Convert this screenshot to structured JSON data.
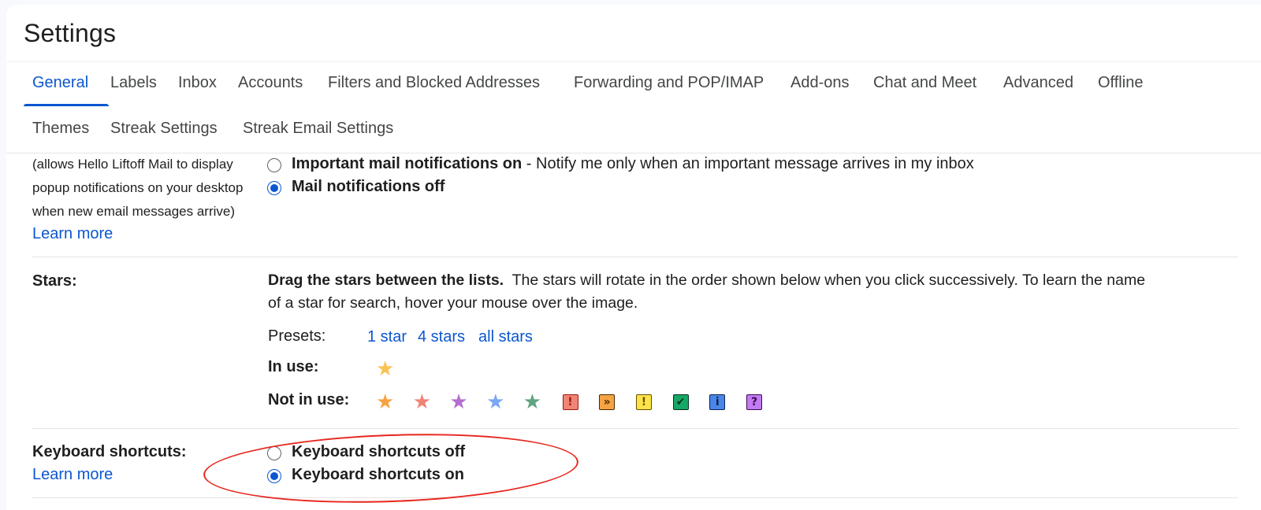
{
  "header": {
    "title": "Settings"
  },
  "tabs": [
    {
      "label": "General",
      "active": true
    },
    {
      "label": "Labels"
    },
    {
      "label": "Inbox"
    },
    {
      "label": "Accounts"
    },
    {
      "label": "Filters and Blocked Addresses"
    },
    {
      "label": "Forwarding and POP/IMAP"
    },
    {
      "label": "Add-ons"
    },
    {
      "label": "Chat and Meet"
    },
    {
      "label": "Advanced"
    },
    {
      "label": "Offline"
    },
    {
      "label": "Themes"
    },
    {
      "label": "Streak Settings"
    },
    {
      "label": "Streak Email Settings"
    }
  ],
  "notifications": {
    "desc_lines": [
      "(allows Hello Liftoff Mail to display",
      "popup notifications on your desktop",
      "when new email messages arrive)"
    ],
    "learn_more": "Learn more",
    "options": [
      {
        "bold": "Important mail notifications on",
        "rest": " - Notify me only when an important message arrives in my inbox",
        "checked": false
      },
      {
        "bold": "Mail notifications off",
        "rest": "",
        "checked": true
      }
    ]
  },
  "stars": {
    "label": "Stars:",
    "intro_bold": "Drag the stars between the lists.",
    "intro_line1": "  The stars will rotate in the order shown below when you click successively. To learn the name",
    "intro_line2": "of a star for search, hover your mouse over the image.",
    "presets_label": "Presets:",
    "presets": [
      "1 star",
      "4 stars",
      "all stars"
    ],
    "in_use_label": "In use:",
    "not_in_use_label": "Not in use:",
    "in_use": [
      {
        "icon": "yellow-star-icon",
        "color": "#fbc254"
      }
    ],
    "not_in_use": [
      {
        "icon": "orange-star-icon",
        "color": "#f6a443"
      },
      {
        "icon": "red-star-icon",
        "color": "#f08476"
      },
      {
        "icon": "purple-star-icon",
        "color": "#b46ece"
      },
      {
        "icon": "blue-star-icon",
        "color": "#7ba7f4"
      },
      {
        "icon": "green-star-icon",
        "color": "#5fa581"
      },
      {
        "icon": "red-bang-icon",
        "glyph": "!",
        "bg": "#f08476",
        "fg": "#9c1a0f"
      },
      {
        "icon": "orange-guillemet-icon",
        "glyph": "»",
        "bg": "#f6a443",
        "fg": "#4a2a00"
      },
      {
        "icon": "yellow-bang-icon",
        "glyph": "!",
        "bg": "#fce34a",
        "fg": "#6b5000"
      },
      {
        "icon": "green-check-icon",
        "glyph": "✔",
        "bg": "#16a765",
        "fg": "#04341d"
      },
      {
        "icon": "blue-info-icon",
        "glyph": "i",
        "bg": "#4986e7",
        "fg": "#0b2354"
      },
      {
        "icon": "purple-question-icon",
        "glyph": "?",
        "bg": "#c37bf0",
        "fg": "#3a0a57"
      }
    ]
  },
  "shortcuts": {
    "label": "Keyboard shortcuts:",
    "learn_more": "Learn more",
    "options": [
      {
        "bold": "Keyboard shortcuts off",
        "checked": false
      },
      {
        "bold": "Keyboard shortcuts on",
        "checked": true
      }
    ],
    "annotation_color": "#e8261e"
  }
}
